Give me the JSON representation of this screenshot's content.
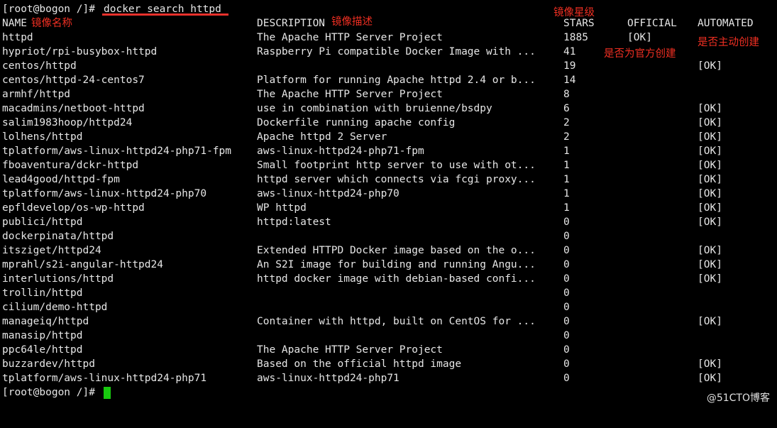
{
  "terminal": {
    "prompt": "[root@bogon /]#",
    "command": "docker search httpd",
    "final_prompt": "[root@bogon /]#"
  },
  "headers": {
    "name": "NAME",
    "description": "DESCRIPTION",
    "stars": "STARS",
    "official": "OFFICIAL",
    "automated": "AUTOMATED"
  },
  "annotations": {
    "name": "镜像名称",
    "description": "镜像描述",
    "stars": "镜像星级",
    "official": "是否为官方创建",
    "automated": "是否主动创建"
  },
  "rows": [
    {
      "name": "httpd",
      "description": "The Apache HTTP Server Project",
      "stars": "1885",
      "official": "[OK]",
      "automated": ""
    },
    {
      "name": "hypriot/rpi-busybox-httpd",
      "description": "Raspberry Pi compatible Docker Image with ...",
      "stars": "41",
      "official": "",
      "automated": ""
    },
    {
      "name": "centos/httpd",
      "description": "",
      "stars": "19",
      "official": "",
      "automated": "[OK]"
    },
    {
      "name": "centos/httpd-24-centos7",
      "description": "Platform for running Apache httpd 2.4 or b...",
      "stars": "14",
      "official": "",
      "automated": ""
    },
    {
      "name": "armhf/httpd",
      "description": "The Apache HTTP Server Project",
      "stars": "8",
      "official": "",
      "automated": ""
    },
    {
      "name": "macadmins/netboot-httpd",
      "description": "use in combination with bruienne/bsdpy",
      "stars": "6",
      "official": "",
      "automated": "[OK]"
    },
    {
      "name": "salim1983hoop/httpd24",
      "description": "Dockerfile running apache config",
      "stars": "2",
      "official": "",
      "automated": "[OK]"
    },
    {
      "name": "lolhens/httpd",
      "description": "Apache httpd 2 Server",
      "stars": "2",
      "official": "",
      "automated": "[OK]"
    },
    {
      "name": "tplatform/aws-linux-httpd24-php71-fpm",
      "description": "aws-linux-httpd24-php71-fpm",
      "stars": "1",
      "official": "",
      "automated": "[OK]"
    },
    {
      "name": "fboaventura/dckr-httpd",
      "description": "Small footprint http server to use with ot...",
      "stars": "1",
      "official": "",
      "automated": "[OK]"
    },
    {
      "name": "lead4good/httpd-fpm",
      "description": "httpd server which connects via fcgi proxy...",
      "stars": "1",
      "official": "",
      "automated": "[OK]"
    },
    {
      "name": "tplatform/aws-linux-httpd24-php70",
      "description": "aws-linux-httpd24-php70",
      "stars": "1",
      "official": "",
      "automated": "[OK]"
    },
    {
      "name": "epfldevelop/os-wp-httpd",
      "description": "WP httpd",
      "stars": "1",
      "official": "",
      "automated": "[OK]"
    },
    {
      "name": "publici/httpd",
      "description": "httpd:latest",
      "stars": "0",
      "official": "",
      "automated": "[OK]"
    },
    {
      "name": "dockerpinata/httpd",
      "description": "",
      "stars": "0",
      "official": "",
      "automated": ""
    },
    {
      "name": "itsziget/httpd24",
      "description": "Extended HTTPD Docker image based on the o...",
      "stars": "0",
      "official": "",
      "automated": "[OK]"
    },
    {
      "name": "mprahl/s2i-angular-httpd24",
      "description": "An S2I image for building and running Angu...",
      "stars": "0",
      "official": "",
      "automated": "[OK]"
    },
    {
      "name": "interlutions/httpd",
      "description": "httpd docker image with debian-based confi...",
      "stars": "0",
      "official": "",
      "automated": "[OK]"
    },
    {
      "name": "trollin/httpd",
      "description": "",
      "stars": "0",
      "official": "",
      "automated": ""
    },
    {
      "name": "cilium/demo-httpd",
      "description": "",
      "stars": "0",
      "official": "",
      "automated": ""
    },
    {
      "name": "manageiq/httpd",
      "description": "Container with httpd, built on CentOS for ...",
      "stars": "0",
      "official": "",
      "automated": "[OK]"
    },
    {
      "name": "manasip/httpd",
      "description": "",
      "stars": "0",
      "official": "",
      "automated": ""
    },
    {
      "name": "ppc64le/httpd",
      "description": "The Apache HTTP Server Project",
      "stars": "0",
      "official": "",
      "automated": ""
    },
    {
      "name": "buzzardev/httpd",
      "description": "Based on the official httpd image",
      "stars": "0",
      "official": "",
      "automated": "[OK]"
    },
    {
      "name": "tplatform/aws-linux-httpd24-php71",
      "description": "aws-linux-httpd24-php71",
      "stars": "0",
      "official": "",
      "automated": "[OK]"
    }
  ],
  "watermark": "@51CTO博客",
  "colors": {
    "background": "#000000",
    "text": "#e6e6e6",
    "annotation": "#ef2f22",
    "cursor": "#18c90f"
  }
}
